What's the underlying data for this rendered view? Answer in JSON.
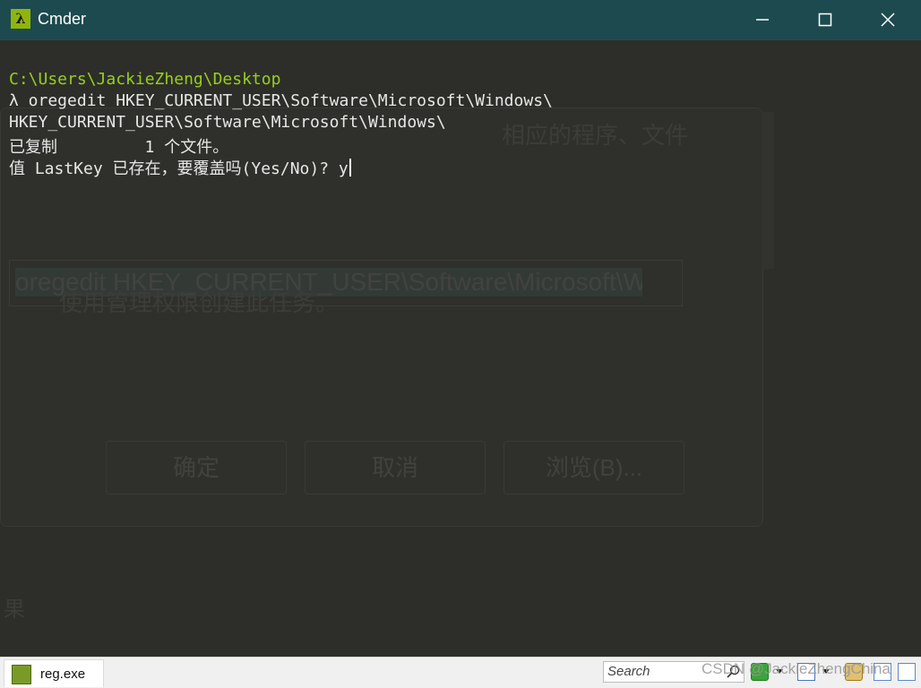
{
  "window": {
    "title": "Cmder",
    "app_icon_glyph": "λ",
    "controls": [
      "minimize",
      "maximize",
      "close"
    ]
  },
  "terminal": {
    "prompt_path": "C:\\Users\\JackieZheng\\Desktop",
    "lines": [
      "λ oregedit HKEY_CURRENT_USER\\Software\\Microsoft\\Windows\\",
      "HKEY_CURRENT_USER\\Software\\Microsoft\\Windows\\",
      "已复制         1 个文件。",
      "值 LastKey 已存在，要覆盖吗(Yes/No)? y"
    ],
    "prompt_color": "#9acd1e",
    "text_color": "#e7e7e7",
    "background": "#2d2e29"
  },
  "ghost_dialog": {
    "description_fragment": "相应的程序、文件",
    "command_text": "oregedit HKEY_CURRENT_USER\\Software\\Microsoft\\Wi",
    "admin_text": "使用管理权限创建此任务。",
    "buttons": [
      "确定",
      "取消",
      "浏览(B)..."
    ],
    "result_fragment": "果"
  },
  "statusbar": {
    "active_tab": "reg.exe",
    "search_placeholder": "Search",
    "watermark": "CSDN @JackieZhengChina"
  },
  "colors": {
    "titlebar": "#1d4a4f",
    "accent_green": "#8fb50c"
  }
}
